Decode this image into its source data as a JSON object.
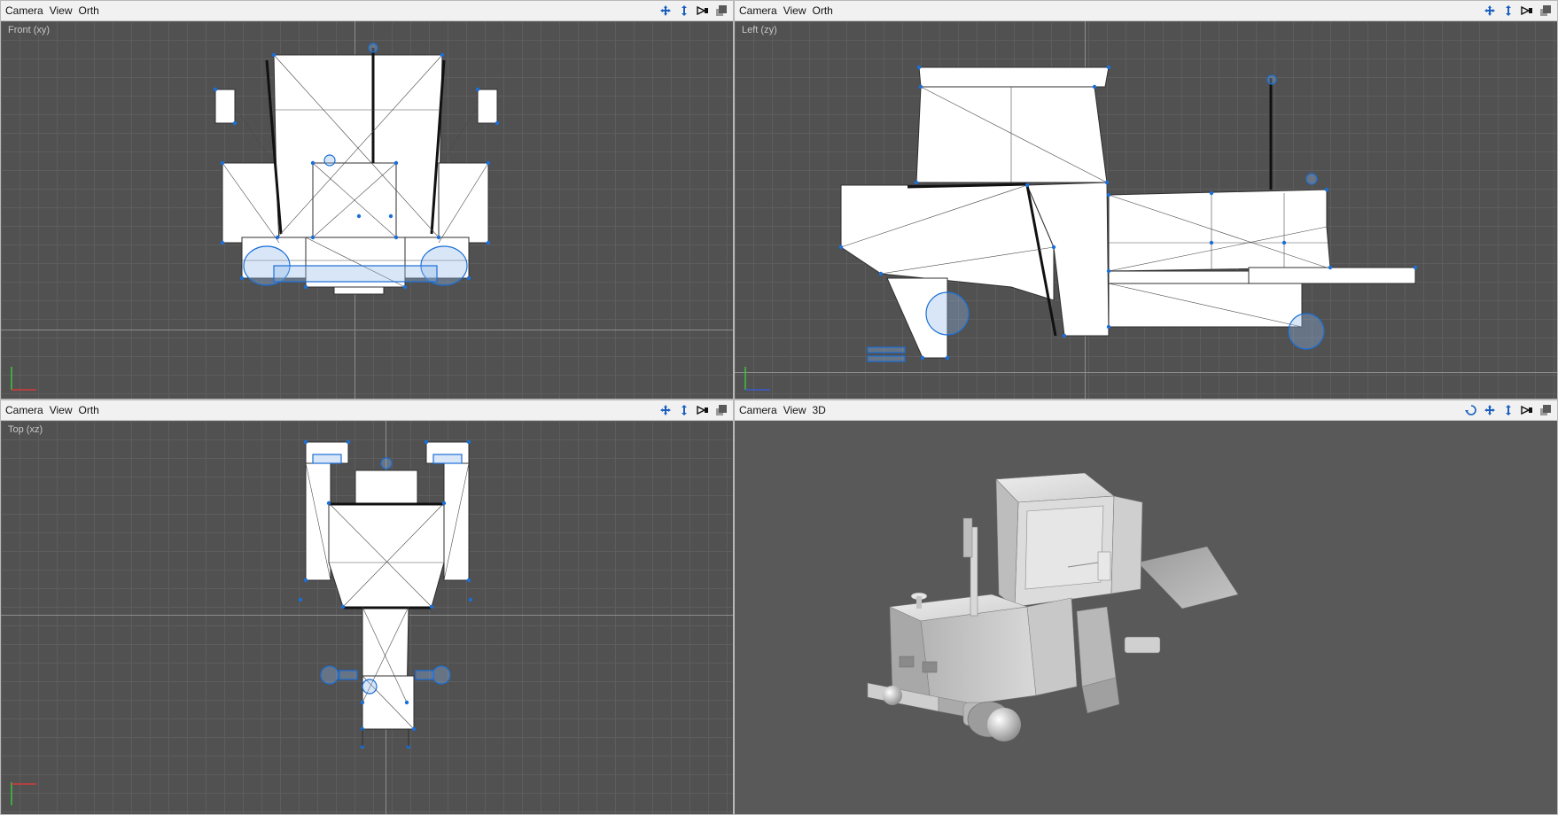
{
  "viewports": {
    "front": {
      "menu": [
        "Camera",
        "View",
        "Orth"
      ],
      "label": "Front (xy)"
    },
    "left": {
      "menu": [
        "Camera",
        "View",
        "Orth"
      ],
      "label": "Left (zy)"
    },
    "top": {
      "menu": [
        "Camera",
        "View",
        "Orth"
      ],
      "label": "Top (xz)"
    },
    "persp": {
      "menu": [
        "Camera",
        "View",
        "3D"
      ]
    }
  },
  "icons": {
    "pan": "move-arrows-icon",
    "zoom": "zoom-arrows-icon",
    "orbit": "orbit-icon",
    "camera": "camera-icon",
    "maximize": "maximize-icon"
  },
  "colors": {
    "grid_bg": "#515151",
    "wire_vertex": "#1a6fd8",
    "mesh_fill": "#ffffff"
  }
}
